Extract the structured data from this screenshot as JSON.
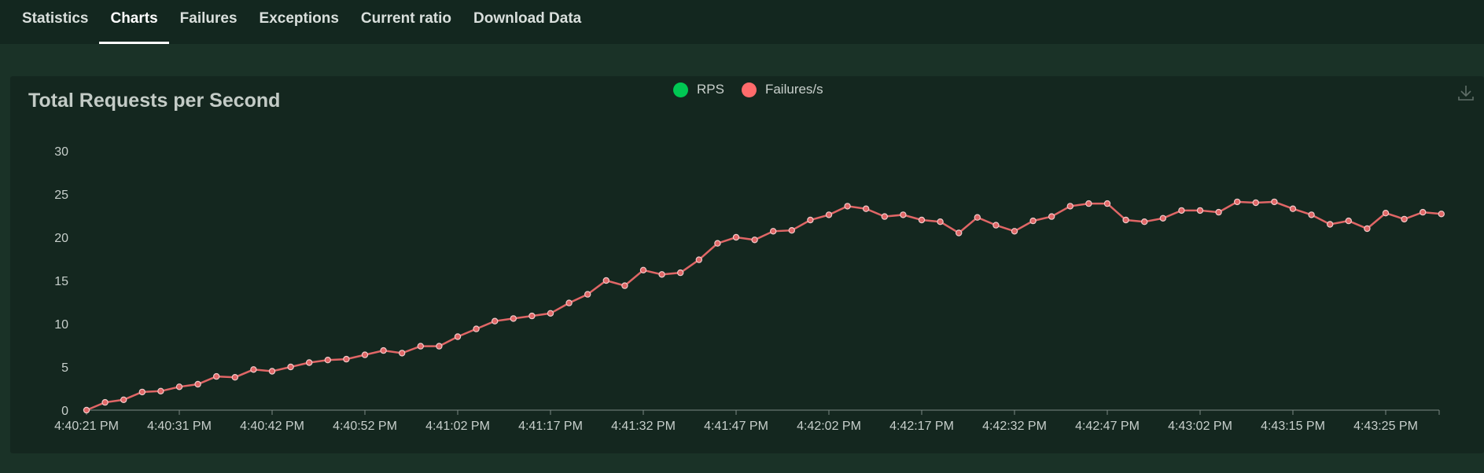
{
  "tabs": [
    {
      "label": "Statistics",
      "active": false
    },
    {
      "label": "Charts",
      "active": true
    },
    {
      "label": "Failures",
      "active": false
    },
    {
      "label": "Exceptions",
      "active": false
    },
    {
      "label": "Current ratio",
      "active": false
    },
    {
      "label": "Download Data",
      "active": false
    }
  ],
  "toolbox": {
    "download_icon": "download-icon"
  },
  "colors": {
    "rps": "#00c853",
    "failures": "#ff6b6b",
    "line": "#e06666",
    "axis": "#7c8a84",
    "background": "#14271f"
  },
  "chart_data": {
    "type": "line",
    "title": "Total Requests per Second",
    "legend": [
      "RPS",
      "Failures/s"
    ],
    "legend_position": "top-center",
    "grid": false,
    "ylim": [
      0,
      30
    ],
    "yticks": [
      "0",
      "5",
      "10",
      "15",
      "20",
      "25",
      "30"
    ],
    "xtick_labels": [
      "4:40:21 PM",
      "4:40:31 PM",
      "4:40:42 PM",
      "4:40:52 PM",
      "4:41:02 PM",
      "4:41:17 PM",
      "4:41:32 PM",
      "4:41:47 PM",
      "4:42:02 PM",
      "4:42:17 PM",
      "4:42:32 PM",
      "4:42:47 PM",
      "4:43:02 PM",
      "4:43:15 PM",
      "4:43:25 PM"
    ],
    "xtick_indices": [
      0,
      5,
      10,
      15,
      20,
      25,
      30,
      35,
      40,
      45,
      50,
      55,
      60,
      65,
      70
    ],
    "series": [
      {
        "name": "Failures/s",
        "values": [
          0,
          0.9,
          1.2,
          2.1,
          2.2,
          2.7,
          3.0,
          3.9,
          3.8,
          4.7,
          4.5,
          5.0,
          5.5,
          5.8,
          5.9,
          6.4,
          6.9,
          6.6,
          7.4,
          7.4,
          8.5,
          9.4,
          10.3,
          10.6,
          10.9,
          11.2,
          12.4,
          13.4,
          15.0,
          14.4,
          16.2,
          15.7,
          15.9,
          17.4,
          19.3,
          20.0,
          19.7,
          20.7,
          20.8,
          22.0,
          22.6,
          23.6,
          23.3,
          22.4,
          22.6,
          22.0,
          21.8,
          20.5,
          22.3,
          21.4,
          20.7,
          21.9,
          22.4,
          23.6,
          23.9,
          23.9,
          22.0,
          21.8,
          22.2,
          23.1,
          23.1,
          22.9,
          24.1,
          24.0,
          24.1,
          23.3,
          22.6,
          21.5,
          21.9,
          21.0,
          22.8,
          22.1,
          22.9,
          22.7
        ]
      }
    ]
  }
}
